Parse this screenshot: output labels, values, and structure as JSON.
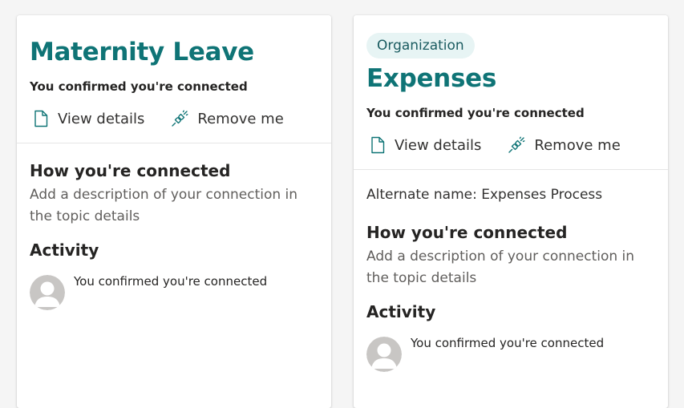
{
  "cards": [
    {
      "chip": "",
      "title": "Maternity Leave",
      "confirmed": "You confirmed you're connected",
      "actions": {
        "view": "View details",
        "remove": "Remove me"
      },
      "alternate_name": "",
      "how_heading": "How you're connected",
      "how_desc": "Add a description of your connection in the topic details",
      "activity_heading": "Activity",
      "activity_item": "You confirmed you're connected"
    },
    {
      "chip": "Organization",
      "title": "Expenses",
      "confirmed": "You confirmed you're connected",
      "actions": {
        "view": "View details",
        "remove": "Remove me"
      },
      "alternate_name": "Alternate name: Expenses Process",
      "how_heading": "How you're connected",
      "how_desc": "Add a description of your connection in the topic details",
      "activity_heading": "Activity",
      "activity_item": "You confirmed you're connected"
    }
  ],
  "colors": {
    "title": "#0f7476",
    "chip_bg": "#e7f4f4",
    "chip_text": "#1a5b60"
  },
  "icons": {
    "view": "document-icon",
    "remove": "unplug-icon",
    "avatar": "default-avatar-icon"
  }
}
